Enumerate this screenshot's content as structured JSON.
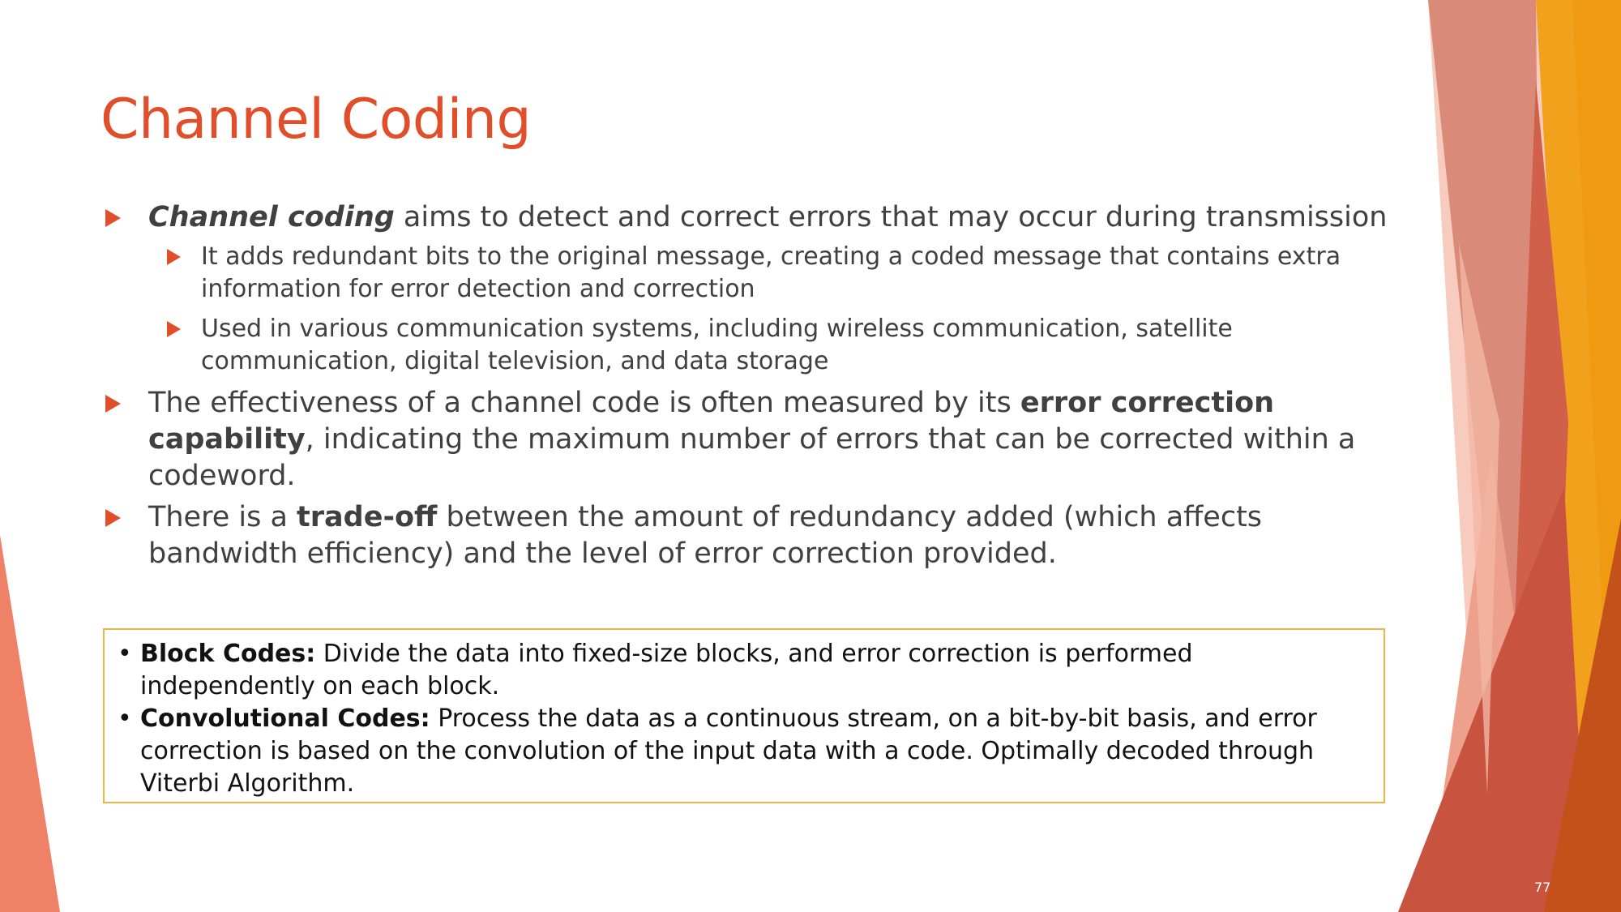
{
  "slide": {
    "title": "Channel Coding",
    "page_number": "77",
    "bullets": [
      {
        "em": "Channel coding",
        "text": " aims to detect and correct errors that may occur during transmission"
      },
      {
        "text": "It adds redundant bits to the original message, creating a coded message that contains extra information for error detection and correction"
      },
      {
        "text": "Used in various communication systems, including wireless communication, satellite communication, digital television, and data storage"
      },
      {
        "pre": "The effectiveness of a channel code is often measured by its ",
        "strong": "error correction capability",
        "post": ", indicating the maximum number of errors that can be corrected within a codeword."
      },
      {
        "pre": "There is a ",
        "strong": "trade-off",
        "post": " between the amount of redundancy added (which affects bandwidth efficiency) and the level of error correction provided."
      }
    ],
    "box": {
      "items": [
        {
          "bullet": "•",
          "term": "Block Codes:",
          "text": " Divide the data into fixed-size blocks, and error correction is performed independently on each block."
        },
        {
          "bullet": "•",
          "term": "Convolutional Codes:",
          "text": " Process the data as a continuous stream, on a bit-by-bit basis, and error correction is based on the convolution of the input data with a code. Optimally decoded through Viterbi Algorithm."
        }
      ]
    }
  },
  "colors": {
    "accent": "#e04e2a",
    "body_text": "#404040",
    "box_border": "#f0b440",
    "decor_orange": "#f39c12",
    "decor_salmon": "#e8806a"
  }
}
